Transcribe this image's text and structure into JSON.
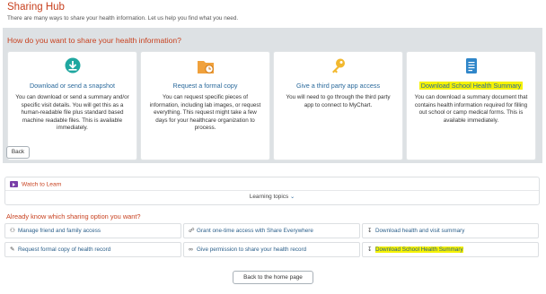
{
  "header": {
    "title": "Sharing Hub",
    "subtitle": "There are many ways to share your health information. Let us help you find what you need."
  },
  "panel": {
    "question": "How do you want to share your health information?",
    "cards": [
      {
        "title": "Download or send a snapshot",
        "icon": "download-icon",
        "description": "You can download or send a summary and/or specific visit details. You will get this as a human-readable file plus standard based machine readable files. This is available immediately."
      },
      {
        "title": "Request a formal copy",
        "icon": "folder-clock-icon",
        "description": "You can request specific pieces of information, including lab images, or request everything. This request might take a few days for your healthcare organization to process."
      },
      {
        "title": "Give a third party app access",
        "icon": "key-icon",
        "description": "You will need to go through the third party app to connect to MyChart."
      },
      {
        "title": "Download School Health Summary",
        "icon": "document-icon",
        "description": "You can download a summary document that contains health information required for filling out school or camp medical forms. This is available immediately."
      }
    ],
    "back_label": "Back"
  },
  "learn": {
    "watch_label": "Watch to Learn",
    "topics_label": "Learning topics"
  },
  "already": {
    "heading": "Already know which sharing option you want?",
    "options": [
      {
        "label": "Manage friend and family access",
        "icon": "people-icon"
      },
      {
        "label": "Grant one-time access with Share Everywhere",
        "icon": "share-icon"
      },
      {
        "label": "Download health and visit summary",
        "icon": "download-icon"
      },
      {
        "label": "Request formal copy of health record",
        "icon": "request-icon"
      },
      {
        "label": "Give permission to share your health record",
        "icon": "link-icon"
      },
      {
        "label": "Download School Health Summary",
        "icon": "download-icon"
      }
    ]
  },
  "home_label": "Back to the home page",
  "colors": {
    "accent": "#c8411f",
    "link": "#2b6a9c",
    "highlight": "#f5f200",
    "panel_bg": "#dde1e4"
  }
}
